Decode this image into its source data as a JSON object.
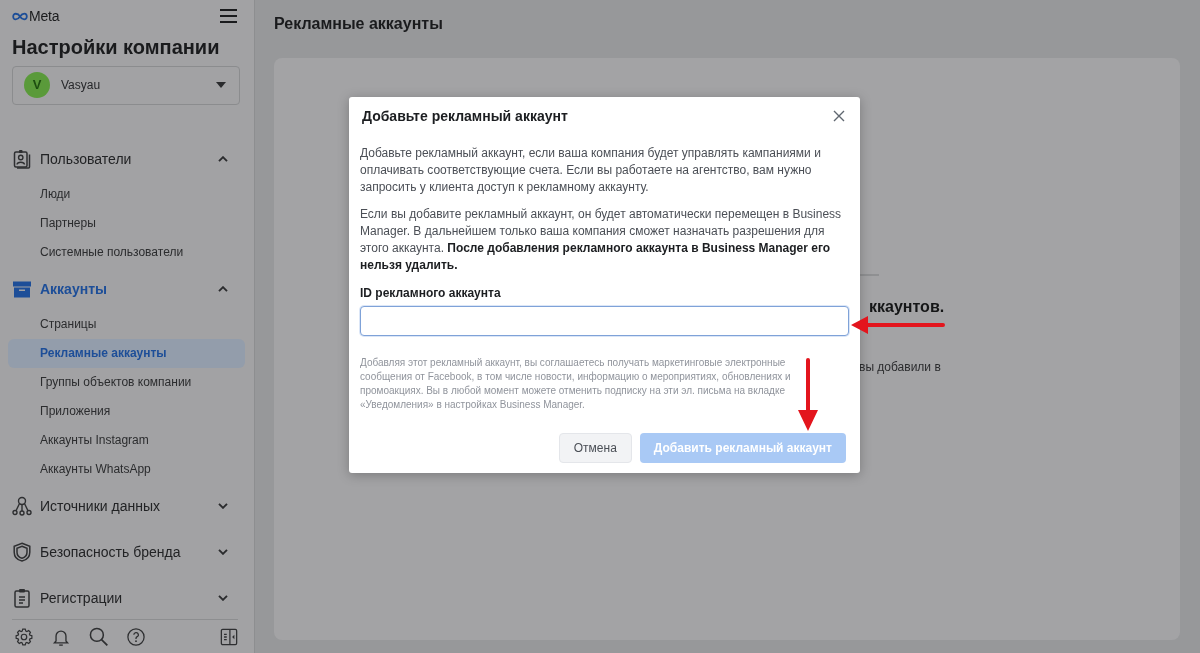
{
  "sidebar": {
    "logo": "Meta",
    "title": "Настройки компании",
    "account": {
      "initial": "V",
      "name": "Vasyau"
    },
    "sections": [
      {
        "label": "Пользователи",
        "selected": false,
        "expanded": true,
        "children": [
          {
            "label": "Люди",
            "selected": false
          },
          {
            "label": "Партнеры",
            "selected": false
          },
          {
            "label": "Системные пользователи",
            "selected": false
          }
        ]
      },
      {
        "label": "Аккаунты",
        "selected": true,
        "expanded": true,
        "children": [
          {
            "label": "Страницы",
            "selected": false
          },
          {
            "label": "Рекламные аккаунты",
            "selected": true
          },
          {
            "label": "Группы объектов компании",
            "selected": false
          },
          {
            "label": "Приложения",
            "selected": false
          },
          {
            "label": "Аккаунты Instagram",
            "selected": false
          },
          {
            "label": "Аккаунты WhatsApp",
            "selected": false
          }
        ]
      },
      {
        "label": "Источники данных",
        "selected": false,
        "expanded": false
      },
      {
        "label": "Безопасность бренда",
        "selected": false,
        "expanded": false
      },
      {
        "label": "Регистрации",
        "selected": false,
        "expanded": false
      }
    ]
  },
  "main": {
    "title": "Рекламные аккаунты",
    "empty_state": {
      "heading": "ккаунтов.",
      "text": "вы добавили в"
    }
  },
  "dialog": {
    "title": "Добавьте рекламный аккаунт",
    "paragraphs": [
      "Добавьте рекламный аккаунт, если ваша компания будет управлять кампаниями и оплачивать соответствующие счета. Если вы работаете на агентство, вам нужно запросить у клиента доступ к рекламному аккаунту.",
      "Если вы добавите рекламный аккаунт, он будет автоматически перемещен в Business Manager. В дальнейшем только ваша компания сможет назначать разрешения для этого аккаунта. **После добавления рекламного аккаунта в Business Manager его нельзя удалить.**"
    ],
    "field": {
      "label": "ID рекламного аккаунта"
    },
    "consent": "Добавляя этот рекламный аккаунт, вы соглашаетесь получать маркетинговые электронные сообщения от Facebook, в том числе новости, информацию о мероприятиях, обновлениях и промоакциях. Вы в любой момент можете отменить подписку на эти эл. письма на вкладке «Уведомления» в настройках Business Manager.",
    "buttons": [
      {
        "label": "Отмена",
        "kind": "secondary",
        "disabled": false
      },
      {
        "label": "Добавить рекламный аккаунт",
        "kind": "primary",
        "disabled": true
      }
    ]
  }
}
